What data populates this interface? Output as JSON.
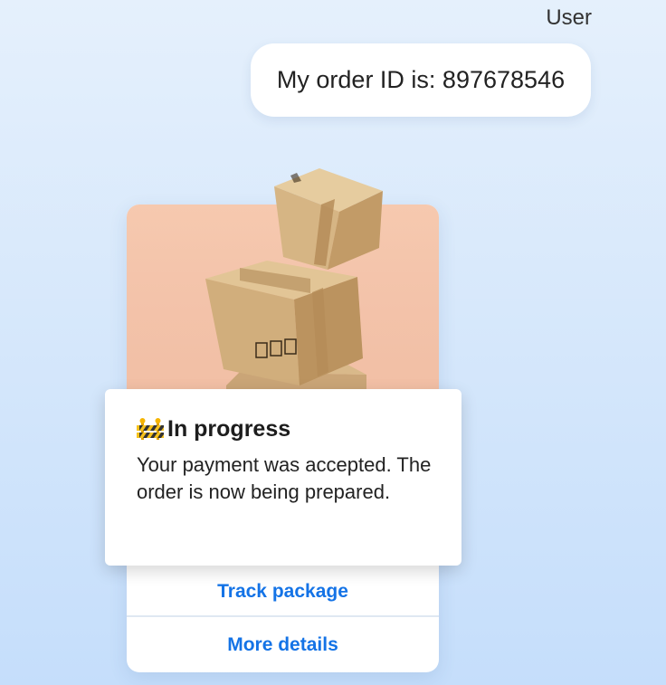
{
  "message": {
    "sender": "User",
    "text": "My order ID is: 897678546"
  },
  "order_card": {
    "status_icon": "construction-barrier-icon",
    "status_title": "In progress",
    "status_description": "Your payment was accepted. The order is now being prepared.",
    "actions": [
      {
        "label": "Track package"
      },
      {
        "label": "More details"
      }
    ],
    "image_alt": "stacked-cardboard-boxes"
  },
  "colors": {
    "accent": "#1473e6",
    "image_background": "#f3c3aa",
    "page_background": "#d7e8fb"
  }
}
